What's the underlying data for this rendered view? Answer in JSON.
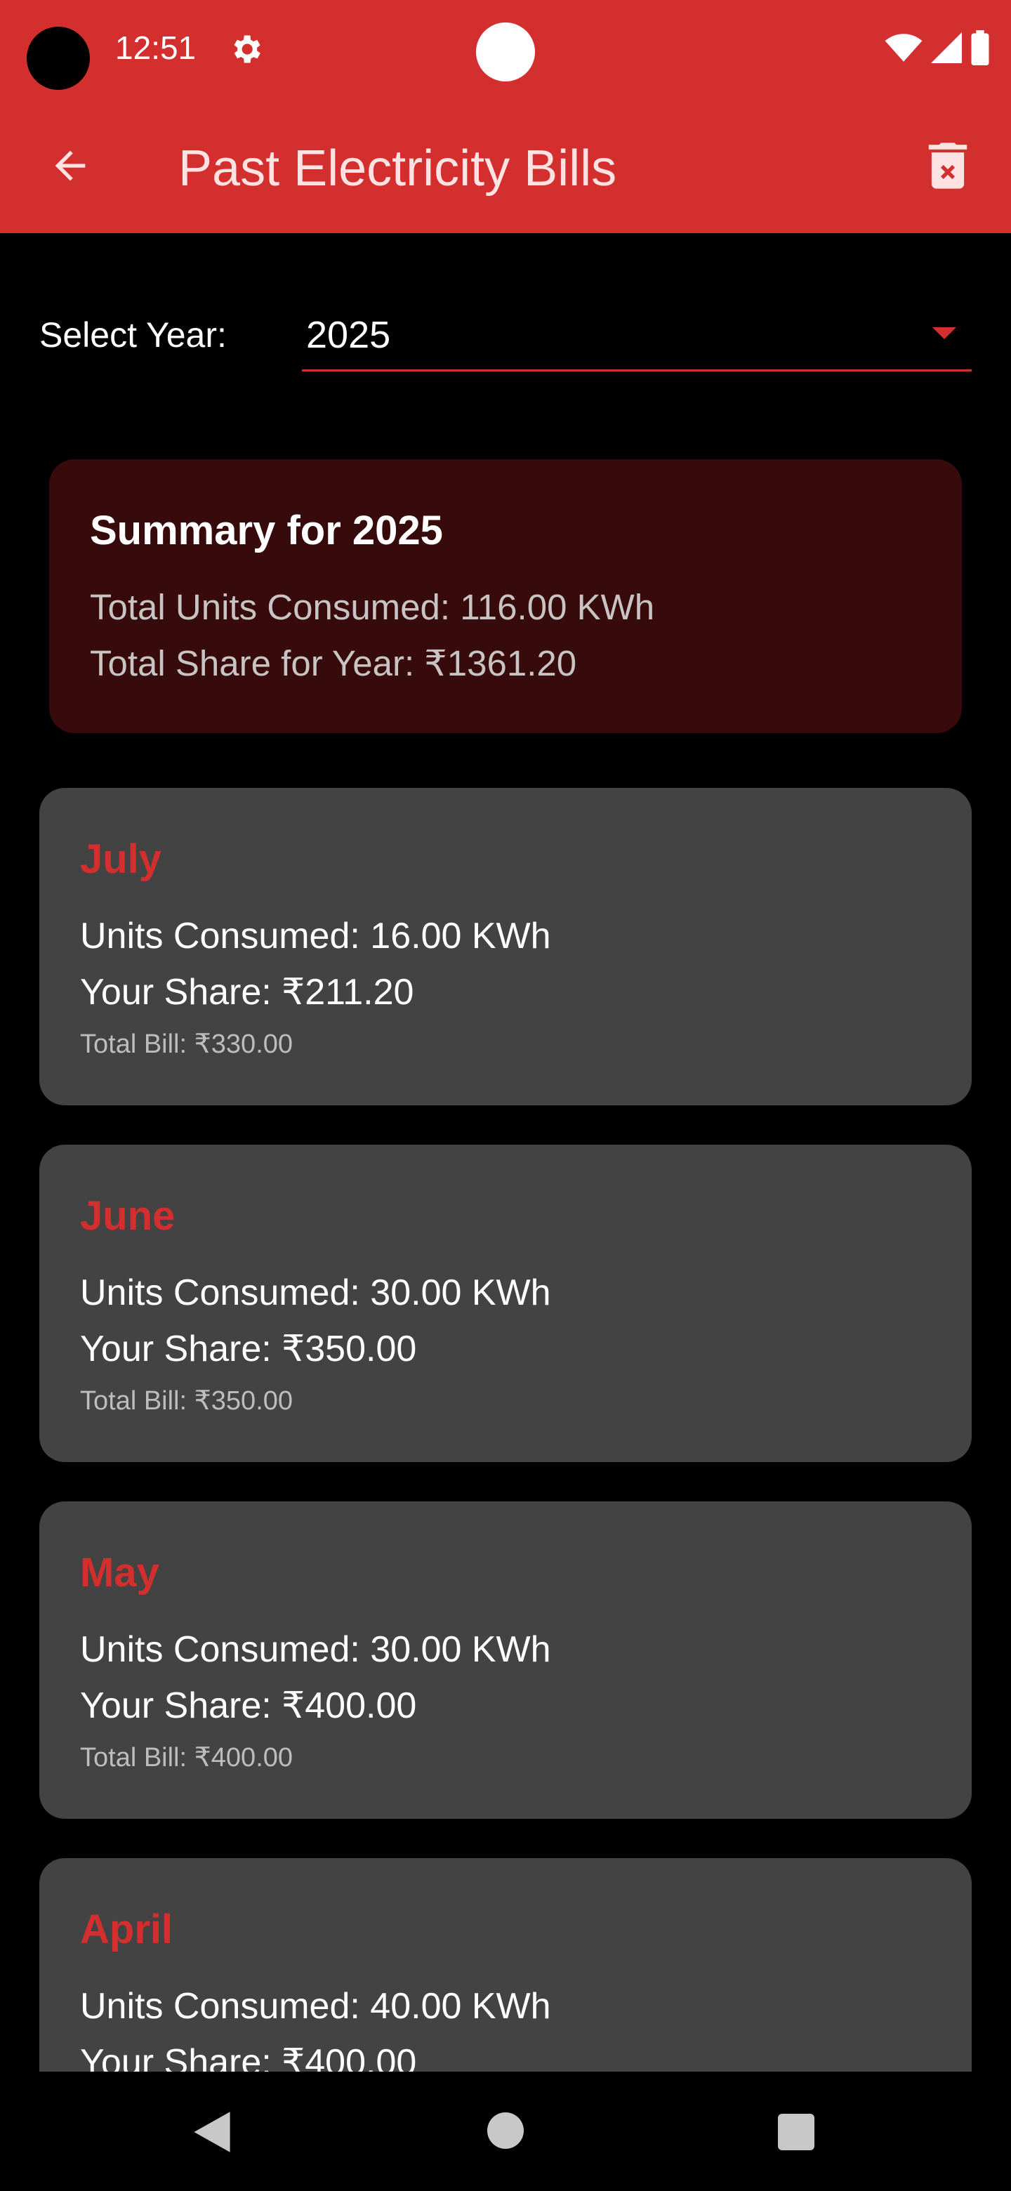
{
  "status_bar": {
    "time": "12:51",
    "icons": [
      "settings-icon",
      "wifi-icon",
      "signal-icon",
      "battery-icon"
    ]
  },
  "app_bar": {
    "title": "Past Electricity Bills",
    "back_icon": "arrow-back-icon",
    "action_icon": "delete-forever-icon"
  },
  "year_selector": {
    "label": "Select Year:",
    "selected": "2025"
  },
  "summary": {
    "title": "Summary for 2025",
    "total_units": "Total Units Consumed: 116.00 KWh",
    "total_share": "Total Share for Year: ₹1361.20"
  },
  "months": [
    {
      "name": "July",
      "units": "Units Consumed: 16.00 KWh",
      "share": "Your Share: ₹211.20",
      "total": "Total Bill: ₹330.00"
    },
    {
      "name": "June",
      "units": "Units Consumed: 30.00 KWh",
      "share": "Your Share: ₹350.00",
      "total": "Total Bill: ₹350.00"
    },
    {
      "name": "May",
      "units": "Units Consumed: 30.00 KWh",
      "share": "Your Share: ₹400.00",
      "total": "Total Bill: ₹400.00"
    },
    {
      "name": "April",
      "units": "Units Consumed: 40.00 KWh",
      "share": "Your Share: ₹400.00",
      "total": ""
    }
  ],
  "colors": {
    "primary": "#d32f2f",
    "background": "#000000",
    "summary_card": "#370a0b",
    "month_card": "#434343"
  },
  "nav_bar": {
    "icons": [
      "nav-back-icon",
      "nav-home-icon",
      "nav-recents-icon"
    ]
  }
}
